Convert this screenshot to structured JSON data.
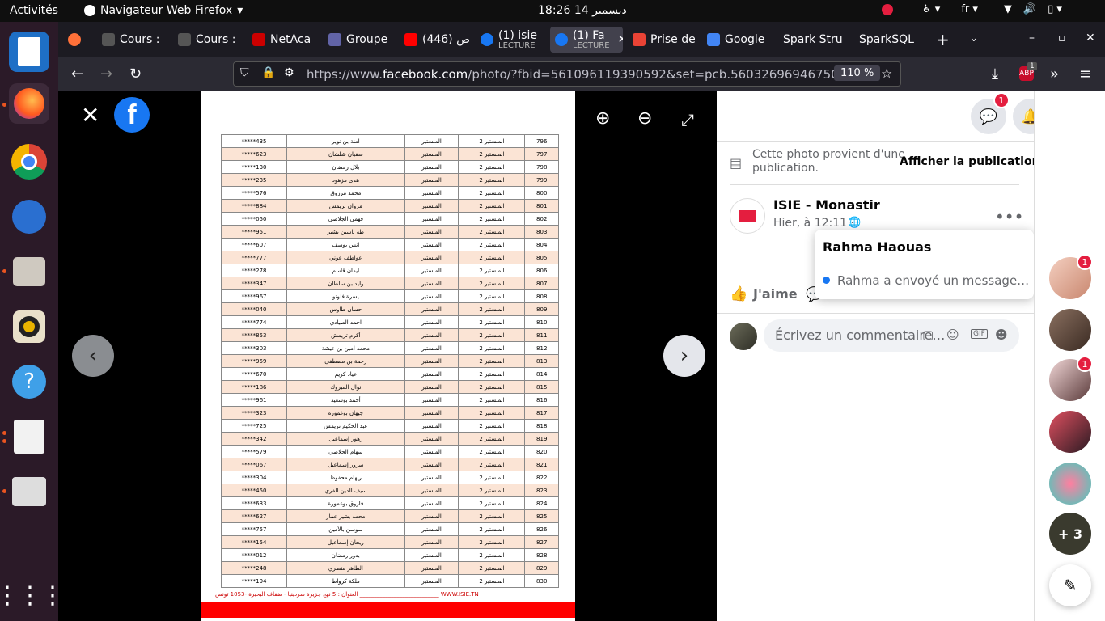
{
  "topbar": {
    "activities": "Activités",
    "app_name": "Navigateur Web Firefox",
    "clock": "ديسمبر 14  18:26",
    "lang": "fr"
  },
  "tabs": [
    {
      "label": "Cours :",
      "sub": ""
    },
    {
      "label": "Cours :",
      "sub": ""
    },
    {
      "label": "NetAca",
      "sub": ""
    },
    {
      "label": "Groupe",
      "sub": ""
    },
    {
      "label": "(446) ص",
      "sub": ""
    },
    {
      "label": "(1) isie",
      "sub": "LECTURE"
    },
    {
      "label": "(1) Fa",
      "sub": "LECTURE"
    },
    {
      "label": "Prise de",
      "sub": ""
    },
    {
      "label": "Google",
      "sub": ""
    },
    {
      "label": "Spark Stru",
      "sub": ""
    },
    {
      "label": "SparkSQL",
      "sub": ""
    }
  ],
  "navbar": {
    "url_prefix": "https://www.",
    "url_domain": "facebook.com",
    "url_rest": "/photo/?fbid=561096119390592&set=pcb.560326969467507",
    "zoom": "110 %",
    "abp_badge": "1"
  },
  "viewer": {
    "col_city": "المنستير",
    "col_circ": "المنستير 2",
    "footer": "العنوان : 5 نهج جزيرة سردينيا - ضفاف البحيرة -1053 تونس ____________________________ WWW.ISIE.TN"
  },
  "rows": [
    {
      "no": "796",
      "name": "امنة بن نوير",
      "id": "*****435"
    },
    {
      "no": "797",
      "name": "سفيان شلشان",
      "id": "*****623"
    },
    {
      "no": "798",
      "name": "بلال رمضان",
      "id": "*****130"
    },
    {
      "no": "799",
      "name": "هدى مزهود",
      "id": "*****235"
    },
    {
      "no": "800",
      "name": "محمد مرزوق",
      "id": "*****576"
    },
    {
      "no": "801",
      "name": "مروان تريمش",
      "id": "*****884"
    },
    {
      "no": "802",
      "name": "فهمي الجلاصي",
      "id": "*****050"
    },
    {
      "no": "803",
      "name": "طه ياسين بشير",
      "id": "*****951"
    },
    {
      "no": "804",
      "name": "انس يوسف",
      "id": "*****607"
    },
    {
      "no": "805",
      "name": "عواطف عوني",
      "id": "*****777"
    },
    {
      "no": "806",
      "name": "ايمان قاسم",
      "id": "*****278"
    },
    {
      "no": "807",
      "name": "وليد بن سلطان",
      "id": "*****347"
    },
    {
      "no": "808",
      "name": "يسرة فلوتو",
      "id": "*****967"
    },
    {
      "no": "809",
      "name": "حسان طاوس",
      "id": "*****040"
    },
    {
      "no": "810",
      "name": "احمد الصيادي",
      "id": "*****774"
    },
    {
      "no": "811",
      "name": "أكرم تريمش",
      "id": "*****853"
    },
    {
      "no": "812",
      "name": "محمد امين بن عيشة",
      "id": "*****303"
    },
    {
      "no": "813",
      "name": "رحمة بن مصطفى",
      "id": "*****959"
    },
    {
      "no": "814",
      "name": "عياد كريم",
      "id": "*****670"
    },
    {
      "no": "815",
      "name": "نوال المبروك",
      "id": "*****186"
    },
    {
      "no": "816",
      "name": "أحمد بوسعيد",
      "id": "*****961"
    },
    {
      "no": "817",
      "name": "جيهان بوغمورة",
      "id": "*****323"
    },
    {
      "no": "818",
      "name": "عبد الحكيم تريمش",
      "id": "*****725"
    },
    {
      "no": "819",
      "name": "زهور إسماعيل",
      "id": "*****342"
    },
    {
      "no": "820",
      "name": "سهام الجلاصي",
      "id": "*****579"
    },
    {
      "no": "821",
      "name": "سرور إسماعيل",
      "id": "*****067"
    },
    {
      "no": "822",
      "name": "ريهام محفوظ",
      "id": "*****304"
    },
    {
      "no": "823",
      "name": "سيف الدين الفري",
      "id": "*****450"
    },
    {
      "no": "824",
      "name": "فاروق بوغمورة",
      "id": "*****633"
    },
    {
      "no": "825",
      "name": "محمد بشير عمار",
      "id": "*****627"
    },
    {
      "no": "826",
      "name": "سوسن بالأمين",
      "id": "*****757"
    },
    {
      "no": "827",
      "name": "ريحان إسماعيل",
      "id": "*****154"
    },
    {
      "no": "828",
      "name": "بدور رمضان",
      "id": "*****012"
    },
    {
      "no": "829",
      "name": "الطاهر منصري",
      "id": "*****248"
    },
    {
      "no": "830",
      "name": "ملكة كرواط",
      "id": "*****194"
    }
  ],
  "header": {
    "messenger_badge": "1",
    "notif_badge": "1"
  },
  "post": {
    "origin_text_1": "Cette photo provient d'une",
    "origin_text_2": "publication.",
    "show_post": "Afficher la publication",
    "author": "ISIE - Monastir",
    "time": "Hier, à 12:11 ·",
    "like": "J'aime",
    "comment_placeholder": "Écrivez un commentaire…"
  },
  "popup": {
    "name": "Rahma Haouas",
    "message": "Rahma a envoyé un message…"
  },
  "rail": {
    "badge1": "1",
    "badge3": "1",
    "more": "+ 3"
  },
  "colors": {
    "fb_blue": "#1877f2",
    "badge_red": "#e41e3f"
  }
}
